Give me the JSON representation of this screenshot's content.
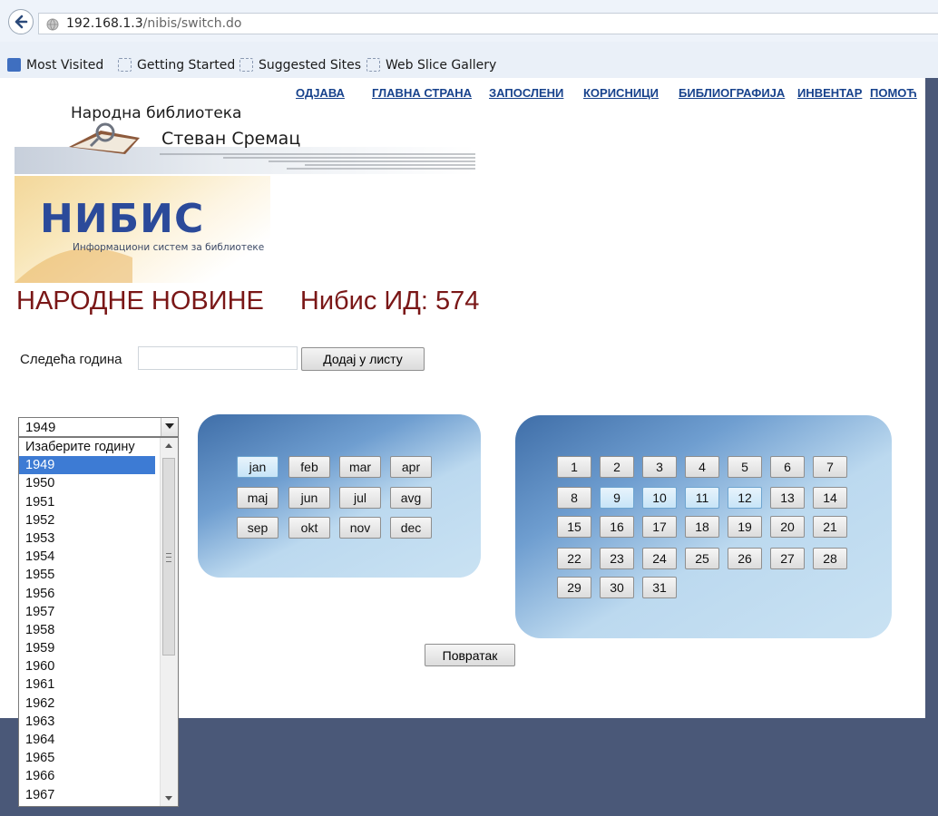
{
  "browser": {
    "url_host": "192.168.1.3",
    "url_path": "/nibis/switch.do",
    "bookmarks": [
      "Most Visited",
      "Getting Started",
      "Suggested Sites",
      "Web Slice Gallery"
    ]
  },
  "nav": {
    "links": [
      "ОДЈАВА",
      "ГЛАВНА СТРАНА",
      "ЗАПОСЛЕНИ",
      "КОРИСНИЦИ",
      "БИБЛИОГРАФИЈА",
      "ИНВЕНТАР",
      "ПОМОЋ"
    ]
  },
  "logo": {
    "line1": "Народна библиотека",
    "line2": "Стеван Сремац",
    "nibis_title": "НИБИС",
    "nibis_subtitle": "Информациони систем за библиотеке"
  },
  "heading": {
    "title": "НАРОДНЕ НОВИНЕ",
    "nibis_id": "Нибис ИД: 574"
  },
  "next_year": {
    "label": "Следећа година",
    "value": "",
    "button": "Додај у листу"
  },
  "year_select": {
    "selected": "1949",
    "options": [
      "Изаберите годину",
      "1949",
      "1950",
      "1951",
      "1952",
      "1953",
      "1954",
      "1955",
      "1956",
      "1957",
      "1958",
      "1959",
      "1960",
      "1961",
      "1962",
      "1963",
      "1964",
      "1965",
      "1966",
      "1967"
    ]
  },
  "months": [
    "jan",
    "feb",
    "mar",
    "apr",
    "maj",
    "jun",
    "jul",
    "avg",
    "sep",
    "okt",
    "nov",
    "dec"
  ],
  "highlighted_month": "jan",
  "days": [
    "1",
    "2",
    "3",
    "4",
    "5",
    "6",
    "7",
    "8",
    "9",
    "10",
    "11",
    "12",
    "13",
    "14",
    "15",
    "16",
    "17",
    "18",
    "19",
    "20",
    "21",
    "22",
    "23",
    "24",
    "25",
    "26",
    "27",
    "28",
    "29",
    "30",
    "31"
  ],
  "highlighted_days": [
    "9",
    "10",
    "11",
    "12"
  ],
  "return_button": "Повратак",
  "colors": {
    "heading": "#7a1717",
    "nav_link": "#17428c",
    "panel_dark": "#3f6ea8",
    "panel_light": "#c9e2f3",
    "page_bg_outer": "#4a5878",
    "selected_option": "#3d7bd4"
  }
}
